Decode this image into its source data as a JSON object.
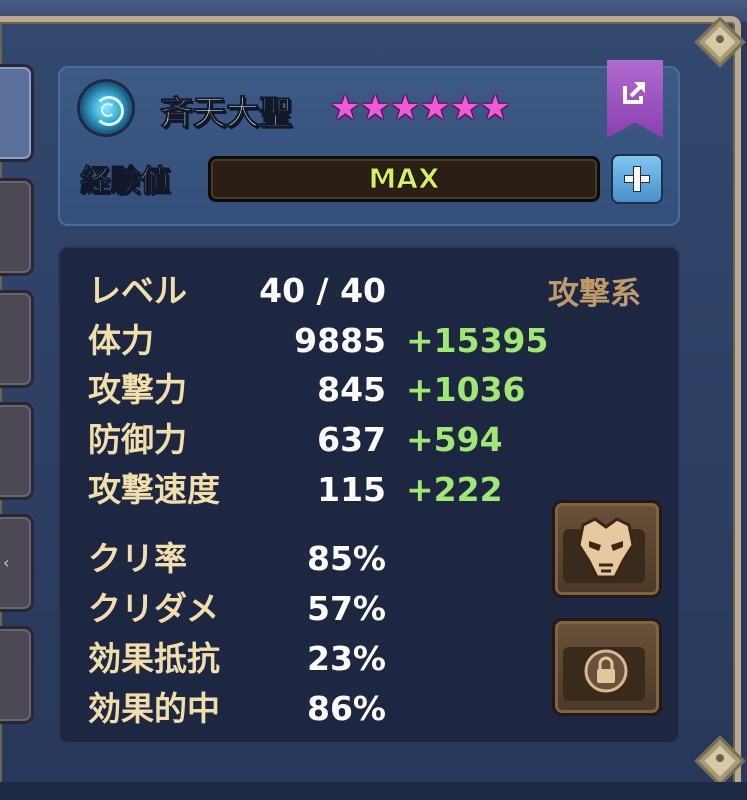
{
  "monster": {
    "name": "斉天大聖",
    "stars": 6,
    "star_glyph": "★",
    "element_icon": "wind-swirl-icon",
    "accent_color": "#f05ad9"
  },
  "experience": {
    "label": "経験値",
    "bar_text": "MAX",
    "progress": 1.0
  },
  "stats": {
    "type_label": "攻撃系",
    "level": {
      "label": "レベル",
      "value": "40 / 40"
    },
    "rows": [
      {
        "label": "体力",
        "value": "9885",
        "bonus": "+15395"
      },
      {
        "label": "攻撃力",
        "value": "845",
        "bonus": "+1036"
      },
      {
        "label": "防御力",
        "value": "637",
        "bonus": "+594"
      },
      {
        "label": "攻撃速度",
        "value": "115",
        "bonus": "+222"
      }
    ],
    "secondary": [
      {
        "label": "クリ率",
        "value": "85%"
      },
      {
        "label": "クリダメ",
        "value": "57%"
      },
      {
        "label": "効果抵抗",
        "value": "23%"
      },
      {
        "label": "効果的中",
        "value": "86%"
      }
    ]
  },
  "buttons": {
    "share_icon": "share-export-icon",
    "exp_add_icon": "plus-icon",
    "skill_icon": "mask-icon",
    "lock_icon": "lock-icon"
  },
  "colors": {
    "label": "#f1deaa",
    "bonus": "#9fe872",
    "type_label": "#bf9a6a",
    "exp_text": "#d8f05a"
  }
}
